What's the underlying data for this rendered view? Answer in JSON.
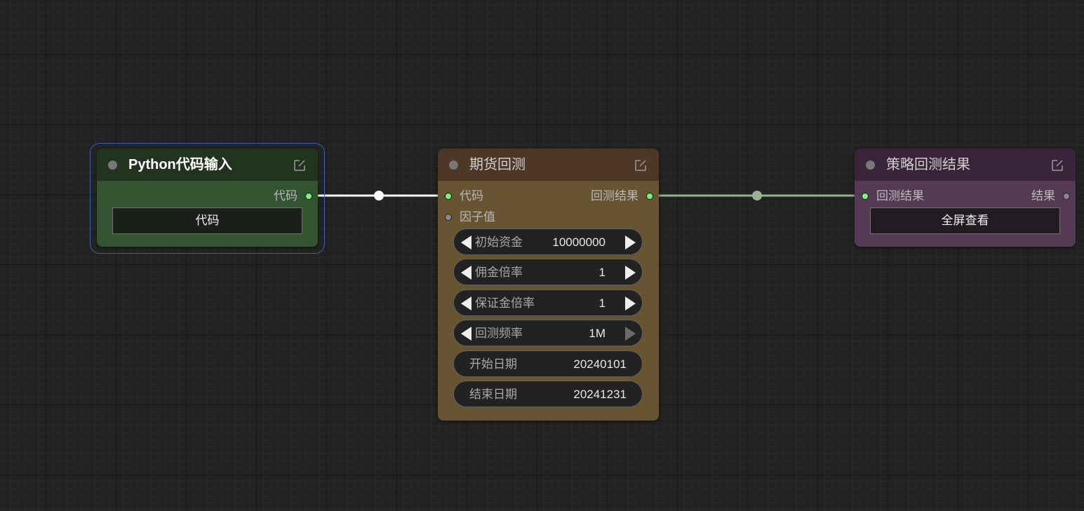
{
  "colors": {
    "canvas_bg": "#222222",
    "link_active": "#ffffff",
    "link_result": "#9aae9a",
    "socket_connected": "#7ef27e",
    "socket_idle": "#8a8a8a",
    "selection_outline": "#3a5fb0"
  },
  "nodes": {
    "python_input": {
      "title": "Python代码输入",
      "selected": true,
      "header_color": "#22331f",
      "body_color": "#335331",
      "outputs": [
        {
          "label": "代码",
          "connected": true
        }
      ],
      "button_label": "代码"
    },
    "futures_backtest": {
      "title": "期货回测",
      "header_color": "#4d3726",
      "body_color": "#665432",
      "inputs": [
        {
          "label": "代码",
          "connected": true
        },
        {
          "label": "因子值",
          "connected": false
        }
      ],
      "outputs": [
        {
          "label": "回测结果",
          "connected": true
        }
      ],
      "widgets": [
        {
          "label": "初始资金",
          "value": "10000000"
        },
        {
          "label": "佣金倍率",
          "value": "1"
        },
        {
          "label": "保证金倍率",
          "value": "1"
        },
        {
          "label": "回测频率",
          "value": "1M"
        },
        {
          "label": "开始日期",
          "value": "20240101"
        },
        {
          "label": "结束日期",
          "value": "20241231"
        }
      ]
    },
    "strategy_result": {
      "title": "策略回测结果",
      "header_color": "#3a2439",
      "body_color": "#553a55",
      "inputs": [
        {
          "label": "回测结果",
          "connected": true
        }
      ],
      "outputs": [
        {
          "label": "结果",
          "connected": false
        }
      ],
      "button_label": "全屏查看"
    }
  },
  "icons": {
    "edit": "edit-icon",
    "status": "status-dot-icon",
    "decrement": "arrow-left-icon",
    "increment": "arrow-right-icon"
  }
}
